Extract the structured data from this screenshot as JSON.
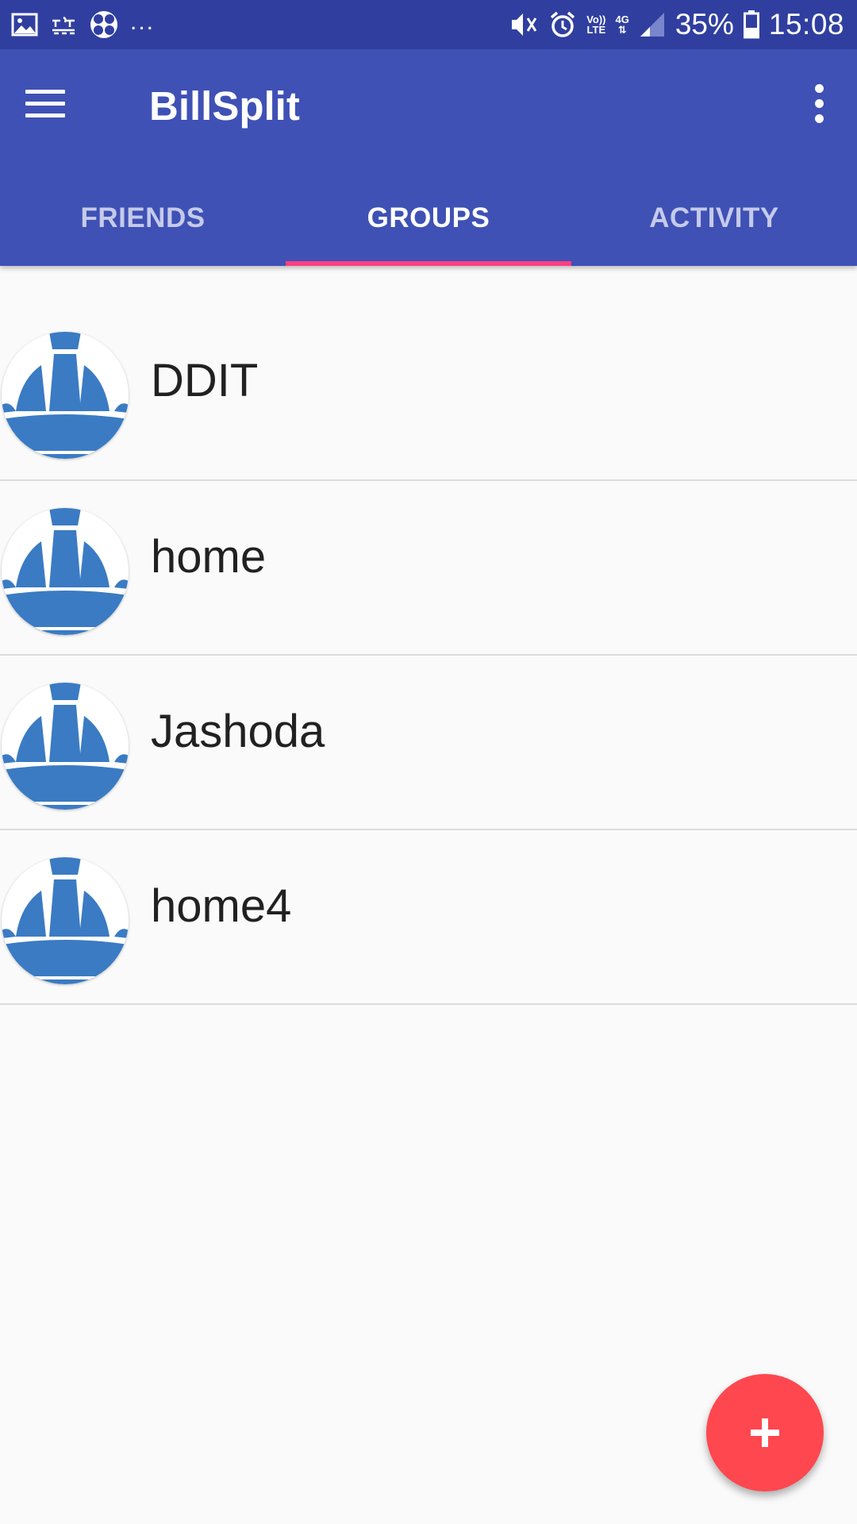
{
  "status_bar": {
    "ellipsis": "...",
    "battery_percent": "35%",
    "time": "15:08",
    "volte": [
      "Vo))",
      "LTE"
    ],
    "network": "4G",
    "icons": [
      "image-icon",
      "news-app-icon",
      "fan-icon",
      "mute-vibrate-icon",
      "alarm-icon",
      "volte-icon",
      "network-4g-icon",
      "signal-icon",
      "battery-icon"
    ]
  },
  "app_bar": {
    "title": "BillSplit",
    "menu_icon": "menu-icon",
    "overflow_icon": "more-vert-icon"
  },
  "tabs": [
    {
      "label": "FRIENDS",
      "active": false
    },
    {
      "label": "GROUPS",
      "active": true
    },
    {
      "label": "ACTIVITY",
      "active": false
    }
  ],
  "groups": [
    {
      "name": "DDIT"
    },
    {
      "name": "home"
    },
    {
      "name": "Jashoda"
    },
    {
      "name": "home4"
    }
  ],
  "fab": {
    "icon": "add-icon"
  },
  "colors": {
    "status_bar": "#303f9f",
    "primary": "#3f51b5",
    "accent": "#ff4081",
    "fab": "#ff474f",
    "avatar_blue": "#3a7bc3"
  }
}
